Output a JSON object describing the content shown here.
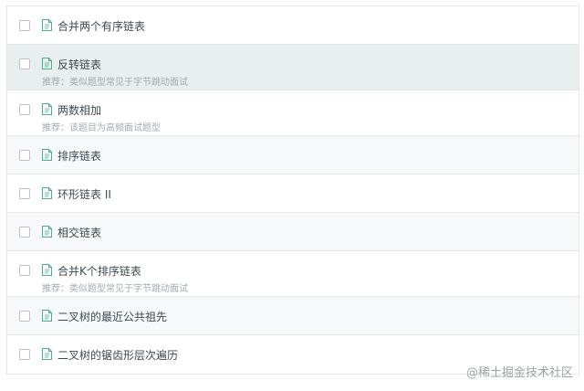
{
  "items": [
    {
      "title": "合并两个有序链表",
      "subtitle": ""
    },
    {
      "title": "反转链表",
      "subtitle": "推荐：类似题型常见于字节跳动面试"
    },
    {
      "title": "两数相加",
      "subtitle": "推荐：该题目为高频面试题型"
    },
    {
      "title": "排序链表",
      "subtitle": ""
    },
    {
      "title": "环形链表 II",
      "subtitle": ""
    },
    {
      "title": "相交链表",
      "subtitle": ""
    },
    {
      "title": "合并K个排序链表",
      "subtitle": "推荐：类似题型常见于字节跳动面试"
    },
    {
      "title": "二叉树的最近公共祖先",
      "subtitle": ""
    },
    {
      "title": "二叉树的锯齿形层次遍历",
      "subtitle": ""
    }
  ],
  "watermark": "@稀土掘金技术社区",
  "colors": {
    "icon": "#4caf8a",
    "active_row": "#e9eeee",
    "alt_row": "#f7f8f9"
  },
  "icons": {
    "checkbox": "checkbox-icon",
    "file": "document-icon"
  }
}
